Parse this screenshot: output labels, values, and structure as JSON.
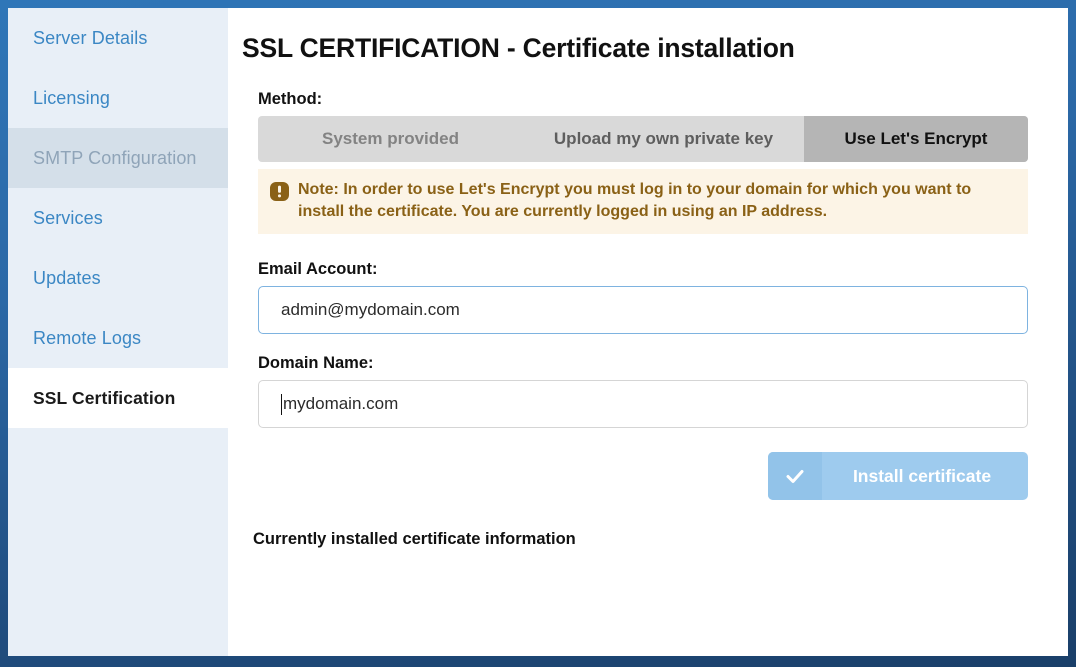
{
  "sidebar": {
    "items": [
      {
        "label": "Server Details",
        "state": "normal"
      },
      {
        "label": "Licensing",
        "state": "normal"
      },
      {
        "label": "SMTP Configuration",
        "state": "hovered"
      },
      {
        "label": "Services",
        "state": "normal"
      },
      {
        "label": "Updates",
        "state": "normal"
      },
      {
        "label": "Remote Logs",
        "state": "normal"
      },
      {
        "label": "SSL Certification",
        "state": "active"
      }
    ]
  },
  "main": {
    "page_title": "SSL CERTIFICATION - Certificate installation",
    "method_label": "Method:",
    "tabs": [
      {
        "label": "System provided",
        "selected": false
      },
      {
        "label": "Upload my own private key",
        "selected": false
      },
      {
        "label": "Use Let's Encrypt",
        "selected": true
      }
    ],
    "note": {
      "icon": "exclamation-icon",
      "text": "Note: In order to use Let's Encrypt you must log in to your domain for which you want to install the certificate. You are currently logged in using an IP address."
    },
    "email_label": "Email Account:",
    "email_value": "admin@mydomain.com",
    "email_placeholder": "Email Account",
    "domain_label": "Domain Name:",
    "domain_value": "mydomain.com",
    "domain_placeholder": "Domain Name",
    "install_button": {
      "label": "Install certificate",
      "icon": "check-icon"
    },
    "installed_info_title": "Currently installed certificate information"
  },
  "colors": {
    "frame_blue": "#2b68a6",
    "frame_blue_dark": "#1a3f69",
    "sidebar_bg": "#e8eff7",
    "sidebar_link": "#3b87c4",
    "active_marker_orange": "#f7a01e",
    "tab_bar_bg": "#d9d9d9",
    "tab_selected_bg": "#b5b5b5",
    "note_bg": "#fcf4e6",
    "note_text": "#8a6116",
    "input_focus_border": "#7eb3e0",
    "button_blue": "#9ecbee"
  }
}
